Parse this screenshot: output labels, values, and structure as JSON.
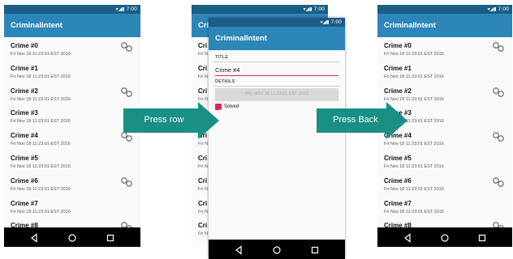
{
  "status": {
    "time": "7:00"
  },
  "app": {
    "title": "CriminalIntent"
  },
  "crimes": [
    {
      "title": "Crime #0",
      "date": "Fri Nov 18 11:23:01 EST 2016",
      "solved": true
    },
    {
      "title": "Crime #1",
      "date": "Fri Nov 18 11:23:01 EST 2016",
      "solved": false
    },
    {
      "title": "Crime #2",
      "date": "Fri Nov 18 11:23:01 EST 2016",
      "solved": true
    },
    {
      "title": "Crime #3",
      "date": "Fri Nov 18 11:23:01 EST 2016",
      "solved": false
    },
    {
      "title": "Crime #4",
      "date": "Fri Nov 18 11:23:01 EST 2016",
      "solved": true
    },
    {
      "title": "Crime #5",
      "date": "Fri Nov 18 11:23:01 EST 2016",
      "solved": false
    },
    {
      "title": "Crime #6",
      "date": "Fri Nov 18 11:23:01 EST 2016",
      "solved": true
    },
    {
      "title": "Crime #7",
      "date": "Fri Nov 18 11:23:01 EST 2016",
      "solved": false
    },
    {
      "title": "Crime #8",
      "date": "Fri Nov 18 11:23:01 EST 2016",
      "solved": true
    }
  ],
  "back_list": {
    "appbar_fragment": "Cri",
    "title_fragment": "Cri",
    "date_fragment": "Fri N"
  },
  "detail": {
    "title_label": "TITLE",
    "title_value": "Crime #4",
    "details_label": "DETAILS",
    "date_button": "FRI NOV 18 11:23:01 EST 2016",
    "solved_label": "Solved",
    "solved": true
  },
  "arrows": {
    "press_row": "Press row",
    "press_back": "Press Back",
    "color": "#1a8f85"
  },
  "colors": {
    "appbar": "#2d86b8",
    "statusbar": "#1b5e85",
    "accent": "#e0245e"
  },
  "icons": {
    "solved": "handcuffs-icon",
    "nav_back": "back-triangle-icon",
    "nav_home": "home-circle-icon",
    "nav_recents": "recents-square-icon",
    "signal": "signal-icon",
    "battery": "battery-icon"
  }
}
